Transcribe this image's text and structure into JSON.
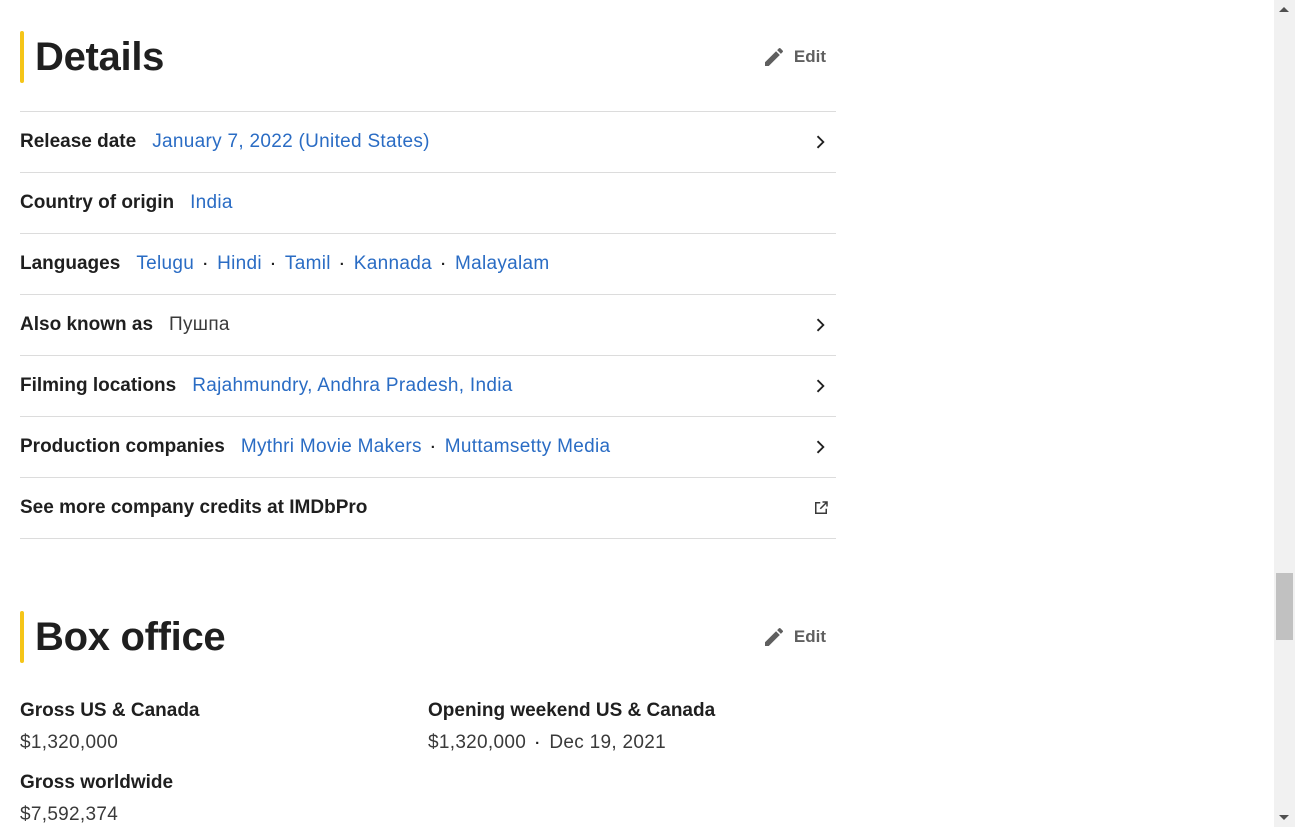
{
  "details": {
    "title": "Details",
    "edit_label": "Edit",
    "release_date": {
      "label": "Release date",
      "value": "January 7, 2022 (United States)"
    },
    "country": {
      "label": "Country of origin",
      "value": "India"
    },
    "languages": {
      "label": "Languages",
      "values": [
        "Telugu",
        "Hindi",
        "Tamil",
        "Kannada",
        "Malayalam"
      ]
    },
    "aka": {
      "label": "Also known as",
      "value": "Пушпа"
    },
    "filming": {
      "label": "Filming locations",
      "value": "Rajahmundry, Andhra Pradesh, India"
    },
    "production": {
      "label": "Production companies",
      "values": [
        "Mythri Movie Makers",
        "Muttamsetty Media"
      ]
    },
    "imdbpro": {
      "label": "See more company credits at IMDbPro"
    }
  },
  "box_office": {
    "title": "Box office",
    "edit_label": "Edit",
    "gross_us": {
      "label": "Gross US & Canada",
      "value": "$1,320,000"
    },
    "opening": {
      "label": "Opening weekend US & Canada",
      "value": "$1,320,000",
      "date": "Dec 19, 2021"
    },
    "gross_world": {
      "label": "Gross worldwide",
      "value": "$7,592,374"
    }
  },
  "separator": "·",
  "icons": {
    "edit": "pencil-icon",
    "chevron": "chevron-right-icon",
    "external": "external-link-icon"
  },
  "colors": {
    "accent": "#f5c518",
    "link": "#2a6cc4"
  }
}
